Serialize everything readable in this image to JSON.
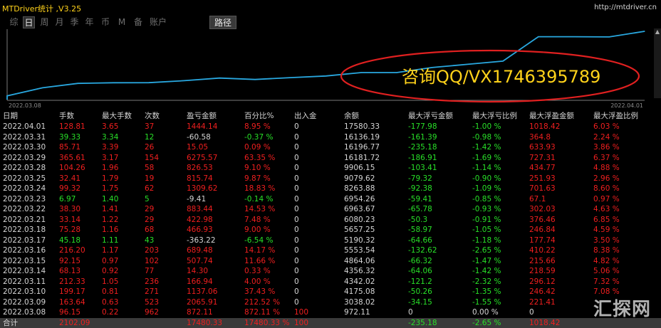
{
  "window": {
    "title": "MTDriver统计 ,V3.25",
    "url": "http://mtdriver.cn"
  },
  "tabs": [
    {
      "label": "综",
      "active": false
    },
    {
      "label": "日",
      "active": true
    },
    {
      "label": "周",
      "active": false
    },
    {
      "label": "月",
      "active": false
    },
    {
      "label": "季",
      "active": false
    },
    {
      "label": "年",
      "active": false
    },
    {
      "label": "币",
      "active": false
    },
    {
      "label": "M",
      "active": false
    },
    {
      "label": "备",
      "active": false
    },
    {
      "label": "账户",
      "active": false
    }
  ],
  "path_tab": "路径",
  "chart": {
    "start_date": "2022.03.08",
    "end_date": "2022.04.01",
    "overlay_text": "咨询QQ/VX1746395789",
    "line_color": "#29a8e0",
    "ellipse_color": "#e02020",
    "overlay_color": "#ffd21a"
  },
  "chart_data": {
    "type": "line",
    "x": [
      "2022.03.08",
      "2022.03.09",
      "2022.03.10",
      "2022.03.11",
      "2022.03.14",
      "2022.03.15",
      "2022.03.16",
      "2022.03.17",
      "2022.03.18",
      "2022.03.21",
      "2022.03.22",
      "2022.03.23",
      "2022.03.24",
      "2022.03.25",
      "2022.03.28",
      "2022.03.29",
      "2022.03.30",
      "2022.03.31",
      "2022.04.01"
    ],
    "values": [
      972.11,
      3038.02,
      4175.08,
      4342.02,
      4356.32,
      4864.06,
      5553.54,
      5190.32,
      5657.25,
      6080.23,
      6963.67,
      6954.26,
      8263.88,
      9079.62,
      9906.15,
      16181.72,
      16196.77,
      16136.19,
      17580.33
    ],
    "series": [
      {
        "values": [
          972.11,
          3038.02,
          4175.08,
          4342.02,
          4356.32,
          4864.06,
          5553.54,
          5190.32,
          5657.25,
          6080.23,
          6963.67,
          6954.26,
          8263.88,
          9079.62,
          9906.15,
          16181.72,
          16196.77,
          16136.19,
          17580.33
        ]
      }
    ],
    "xticks": [
      "2022.03.08",
      "2022.04.01"
    ]
  },
  "table": {
    "headers": [
      "日期",
      "手数",
      "最大手数",
      "次数",
      "盈亏金额",
      "百分比%",
      "出入金",
      "余额",
      "最大浮亏金额",
      "最大浮亏比例",
      "最大浮盈金额",
      "最大浮盈比例"
    ],
    "rows": [
      {
        "c": [
          "2022.04.01",
          "128.81",
          "3.65",
          "37",
          "1444.14",
          "8.95 %",
          "0",
          "17580.33",
          "-177.98",
          "-1.00 %",
          "1018.42",
          "6.03 %"
        ],
        "k": [
          "white",
          "red",
          "red",
          "red",
          "red",
          "red",
          "white",
          "white",
          "green",
          "green",
          "red",
          "red"
        ]
      },
      {
        "c": [
          "2022.03.31",
          "39.33",
          "3.34",
          "12",
          "-60.58",
          "-0.37 %",
          "0",
          "16136.19",
          "-161.39",
          "-0.98 %",
          "364.8",
          "2.24 %"
        ],
        "k": [
          "white",
          "green",
          "green",
          "green",
          "white",
          "green",
          "white",
          "white",
          "green",
          "green",
          "red",
          "red"
        ]
      },
      {
        "c": [
          "2022.03.30",
          "85.71",
          "3.39",
          "26",
          "15.05",
          "0.09 %",
          "0",
          "16196.77",
          "-235.18",
          "-1.42 %",
          "633.93",
          "3.86 %"
        ],
        "k": [
          "white",
          "red",
          "red",
          "red",
          "red",
          "red",
          "white",
          "white",
          "green",
          "green",
          "red",
          "red"
        ]
      },
      {
        "c": [
          "2022.03.29",
          "365.61",
          "3.17",
          "154",
          "6275.57",
          "63.35 %",
          "0",
          "16181.72",
          "-186.91",
          "-1.69 %",
          "727.31",
          "6.37 %"
        ],
        "k": [
          "white",
          "red",
          "red",
          "red",
          "red",
          "red",
          "white",
          "white",
          "green",
          "green",
          "red",
          "red"
        ]
      },
      {
        "c": [
          "2022.03.28",
          "104.26",
          "1.96",
          "58",
          "826.53",
          "9.10 %",
          "0",
          "9906.15",
          "-103.41",
          "-1.14 %",
          "434.77",
          "4.88 %"
        ],
        "k": [
          "white",
          "red",
          "red",
          "red",
          "red",
          "red",
          "white",
          "white",
          "green",
          "green",
          "red",
          "red"
        ]
      },
      {
        "c": [
          "2022.03.25",
          "32.41",
          "1.79",
          "19",
          "815.74",
          "9.87 %",
          "0",
          "9079.62",
          "-79.32",
          "-0.90 %",
          "251.93",
          "2.96 %"
        ],
        "k": [
          "white",
          "red",
          "red",
          "red",
          "red",
          "red",
          "white",
          "white",
          "green",
          "green",
          "red",
          "red"
        ]
      },
      {
        "c": [
          "2022.03.24",
          "99.32",
          "1.75",
          "62",
          "1309.62",
          "18.83 %",
          "0",
          "8263.88",
          "-92.38",
          "-1.09 %",
          "701.63",
          "8.60 %"
        ],
        "k": [
          "white",
          "red",
          "red",
          "red",
          "red",
          "red",
          "white",
          "white",
          "green",
          "green",
          "red",
          "red"
        ]
      },
      {
        "c": [
          "2022.03.23",
          "6.97",
          "1.40",
          "5",
          "-9.41",
          "-0.14 %",
          "0",
          "6954.26",
          "-59.41",
          "-0.85 %",
          "67.1",
          "0.97 %"
        ],
        "k": [
          "white",
          "green",
          "green",
          "green",
          "white",
          "green",
          "white",
          "white",
          "green",
          "green",
          "red",
          "red"
        ]
      },
      {
        "c": [
          "2022.03.22",
          "38.30",
          "1.41",
          "29",
          "883.44",
          "14.53 %",
          "0",
          "6963.67",
          "-65.78",
          "-0.93 %",
          "302.03",
          "4.63 %"
        ],
        "k": [
          "white",
          "red",
          "red",
          "red",
          "red",
          "red",
          "white",
          "white",
          "green",
          "green",
          "red",
          "red"
        ]
      },
      {
        "c": [
          "2022.03.21",
          "33.14",
          "1.22",
          "29",
          "422.98",
          "7.48 %",
          "0",
          "6080.23",
          "-50.3",
          "-0.91 %",
          "376.46",
          "6.85 %"
        ],
        "k": [
          "white",
          "red",
          "red",
          "red",
          "red",
          "red",
          "white",
          "white",
          "green",
          "green",
          "red",
          "red"
        ]
      },
      {
        "c": [
          "2022.03.18",
          "75.28",
          "1.16",
          "68",
          "466.93",
          "9.00 %",
          "0",
          "5657.25",
          "-58.97",
          "-1.05 %",
          "246.84",
          "4.59 %"
        ],
        "k": [
          "white",
          "red",
          "red",
          "red",
          "red",
          "red",
          "white",
          "white",
          "green",
          "green",
          "red",
          "red"
        ]
      },
      {
        "c": [
          "2022.03.17",
          "45.18",
          "1.11",
          "43",
          "-363.22",
          "-6.54 %",
          "0",
          "5190.32",
          "-64.66",
          "-1.18 %",
          "177.74",
          "3.50 %"
        ],
        "k": [
          "white",
          "green",
          "green",
          "green",
          "white",
          "green",
          "white",
          "white",
          "green",
          "green",
          "red",
          "red"
        ]
      },
      {
        "c": [
          "2022.03.16",
          "216.20",
          "1.17",
          "203",
          "689.48",
          "14.17 %",
          "0",
          "5553.54",
          "-132.62",
          "-2.65 %",
          "410.22",
          "8.38 %"
        ],
        "k": [
          "white",
          "red",
          "red",
          "red",
          "red",
          "red",
          "white",
          "white",
          "green",
          "green",
          "red",
          "red"
        ]
      },
      {
        "c": [
          "2022.03.15",
          "92.15",
          "0.97",
          "102",
          "507.74",
          "11.66 %",
          "0",
          "4864.06",
          "-66.32",
          "-1.47 %",
          "215.66",
          "4.82 %"
        ],
        "k": [
          "white",
          "red",
          "red",
          "red",
          "red",
          "red",
          "white",
          "white",
          "green",
          "green",
          "red",
          "red"
        ]
      },
      {
        "c": [
          "2022.03.14",
          "68.13",
          "0.92",
          "77",
          "14.30",
          "0.33 %",
          "0",
          "4356.32",
          "-64.06",
          "-1.42 %",
          "218.59",
          "5.06 %"
        ],
        "k": [
          "white",
          "red",
          "red",
          "red",
          "red",
          "red",
          "white",
          "white",
          "green",
          "green",
          "red",
          "red"
        ]
      },
      {
        "c": [
          "2022.03.11",
          "212.33",
          "1.05",
          "236",
          "166.94",
          "4.00 %",
          "0",
          "4342.02",
          "-121.2",
          "-2.32 %",
          "296.12",
          "7.32 %"
        ],
        "k": [
          "white",
          "red",
          "red",
          "red",
          "red",
          "red",
          "white",
          "white",
          "green",
          "green",
          "red",
          "red"
        ]
      },
      {
        "c": [
          "2022.03.10",
          "199.17",
          "0.81",
          "271",
          "1137.06",
          "37.43 %",
          "0",
          "4175.08",
          "-50.26",
          "-1.35 %",
          "246.42",
          "7.08 %"
        ],
        "k": [
          "white",
          "red",
          "red",
          "red",
          "red",
          "red",
          "white",
          "white",
          "green",
          "green",
          "red",
          "red"
        ]
      },
      {
        "c": [
          "2022.03.09",
          "163.64",
          "0.63",
          "523",
          "2065.91",
          "212.52 %",
          "0",
          "3038.02",
          "-34.15",
          "-1.55 %",
          "221.41",
          ""
        ],
        "k": [
          "white",
          "red",
          "red",
          "red",
          "red",
          "red",
          "white",
          "white",
          "green",
          "green",
          "red",
          "red"
        ]
      },
      {
        "c": [
          "2022.03.08",
          "96.15",
          "0.22",
          "962",
          "872.11",
          "872.11 %",
          "100",
          "972.11",
          "0",
          "0.00 %",
          "0",
          ""
        ],
        "k": [
          "white",
          "red",
          "red",
          "red",
          "red",
          "red",
          "red",
          "white",
          "white",
          "white",
          "white",
          "red"
        ]
      }
    ],
    "total": {
      "c": [
        "合计",
        "2102.09",
        "",
        "",
        "17480.33",
        "17480.33 %",
        "100",
        "",
        "-235.18",
        "-2.65 %",
        "1018.42",
        ""
      ],
      "k": [
        "white",
        "red",
        "red",
        "red",
        "red",
        "red",
        "red",
        "white",
        "green",
        "green",
        "red",
        "red"
      ]
    }
  },
  "watermark": "汇探网"
}
